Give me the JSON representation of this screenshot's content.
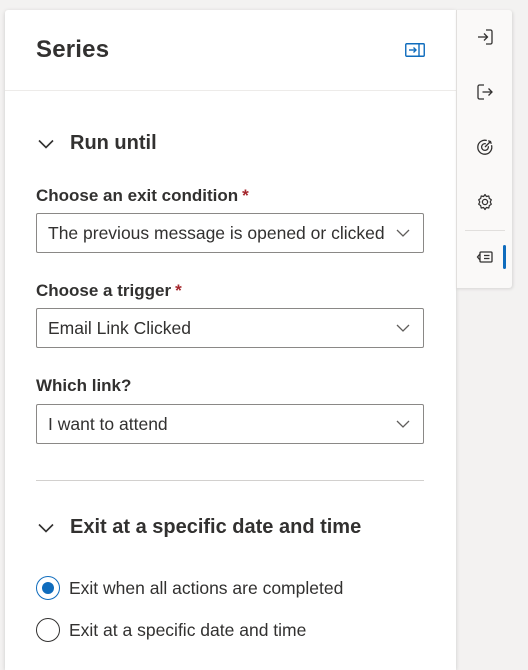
{
  "panel": {
    "title": "Series",
    "collapse_icon": "panel-collapse-icon"
  },
  "run_until": {
    "section_title": "Run until",
    "exit_condition": {
      "label": "Choose an exit condition",
      "required_mark": "*",
      "value": "The previous message is opened or clicked"
    },
    "trigger": {
      "label": "Choose a trigger",
      "required_mark": "*",
      "value": "Email Link Clicked"
    },
    "which_link": {
      "label": "Which link?",
      "value": "I want to attend"
    }
  },
  "exit_section": {
    "section_title": "Exit at a specific date and time",
    "options": [
      {
        "label": "Exit when all actions are completed",
        "checked": true
      },
      {
        "label": "Exit at a specific date and time",
        "checked": false
      }
    ]
  },
  "rail": {
    "items": [
      "sign-in-icon",
      "sign-out-icon",
      "goal-icon",
      "settings-icon",
      "series-properties-icon"
    ],
    "active_index": 4
  },
  "colors": {
    "accent": "#0f6cbd",
    "required": "#a4262c"
  }
}
